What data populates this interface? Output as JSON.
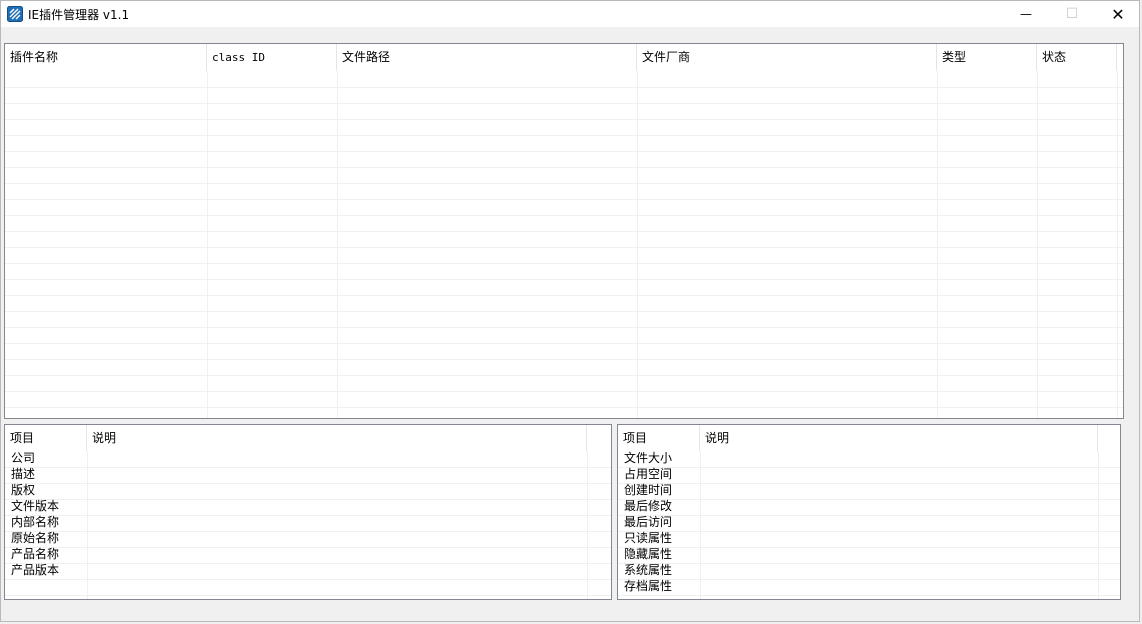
{
  "window": {
    "title": "IE插件管理器 v1.1",
    "icon": "app-icon",
    "controls": {
      "minimize": "—",
      "maximize": "☐",
      "close": "✕"
    }
  },
  "plugin_list": {
    "columns": [
      "插件名称",
      "class ID",
      "文件路径",
      "文件厂商",
      "类型",
      "状态"
    ],
    "rows": []
  },
  "file_info": {
    "columns": [
      "项目",
      "说明"
    ],
    "items": [
      "公司",
      "描述",
      "版权",
      "文件版本",
      "内部名称",
      "原始名称",
      "产品名称",
      "产品版本"
    ]
  },
  "file_attributes": {
    "columns": [
      "项目",
      "说明"
    ],
    "items": [
      "文件大小",
      "占用空间",
      "创建时间",
      "最后修改",
      "最后访问",
      "只读属性",
      "隐藏属性",
      "系统属性",
      "存档属性"
    ]
  }
}
